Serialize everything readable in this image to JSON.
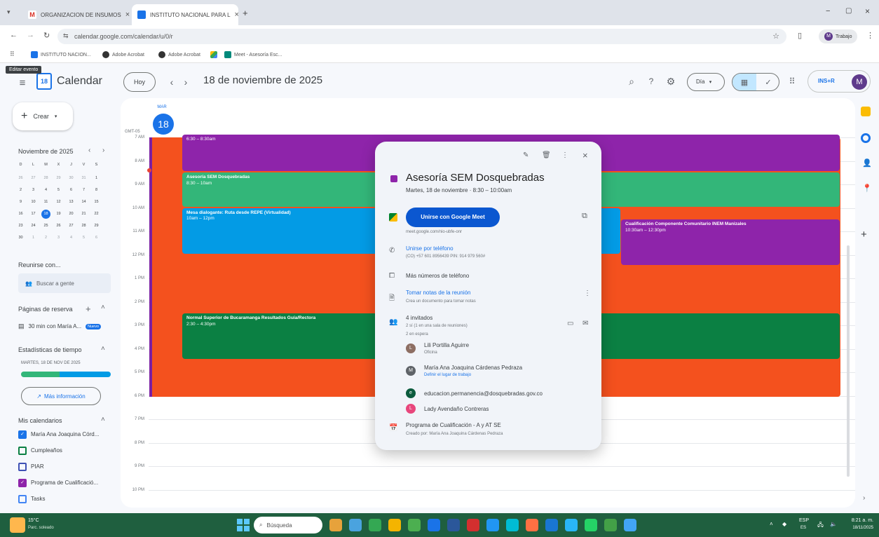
{
  "browser": {
    "tabs": [
      {
        "label": "ORGANIZACION DE INSUMOS",
        "active": false
      },
      {
        "label": "INSTITUTO NACIONAL PARA L",
        "active": true
      }
    ],
    "url": "calendar.google.com/calendar/u/0/r",
    "profile_label": "Trabajo",
    "bookmarks": [
      "INSTITUTO NACION...",
      "Adobe Acrobat",
      "Adobe Acrobat",
      "",
      "Meet - Asesoría Esc..."
    ]
  },
  "tooltip": "Editar evento",
  "header": {
    "app_name": "Calendar",
    "today_button": "Hoy",
    "date_title": "18 de noviembre de 2025",
    "view_select": "Día",
    "avatar_letter": "M",
    "brand": "INS+R"
  },
  "sidebar": {
    "create_label": "Crear",
    "mini_month": "Noviembre de 2025",
    "weekday_letters": [
      "D",
      "L",
      "M",
      "X",
      "J",
      "V",
      "S"
    ],
    "mini_days": [
      [
        "26",
        "27",
        "28",
        "29",
        "30",
        "31",
        "1"
      ],
      [
        "2",
        "3",
        "4",
        "5",
        "6",
        "7",
        "8"
      ],
      [
        "9",
        "10",
        "11",
        "12",
        "13",
        "14",
        "15"
      ],
      [
        "16",
        "17",
        "18",
        "19",
        "20",
        "21",
        "22"
      ],
      [
        "23",
        "24",
        "25",
        "26",
        "27",
        "28",
        "29"
      ],
      [
        "30",
        "1",
        "2",
        "3",
        "4",
        "5",
        "6"
      ]
    ],
    "meet_with": "Reunirse con...",
    "search_people": "Buscar a gente",
    "booking_title": "Páginas de reserva",
    "booking_item": "30 min con María A...",
    "booking_badge": "Nuevo",
    "stats_title": "Estadísticas de tiempo",
    "stats_date": "MARTES, 18 DE NOV DE 2025",
    "more_info": "Más información",
    "my_calendars": "Mis calendarios",
    "calendars": [
      {
        "label": "María Ana Joaquina Córd...",
        "checked": true,
        "color": "#1a73e8"
      },
      {
        "label": "Cumpleaños",
        "checked": false,
        "color": "#0b8043"
      },
      {
        "label": "PIAR",
        "checked": false,
        "color": "#3f51b5"
      },
      {
        "label": "Programa de Cualificació...",
        "checked": true,
        "color": "#8e24aa"
      },
      {
        "label": "Tasks",
        "checked": false,
        "color": "#4285f4"
      }
    ]
  },
  "day_header": {
    "weekday": "MAR",
    "day": "18",
    "timezone": "GMT-05"
  },
  "hours": [
    "7 AM",
    "8 AM",
    "9 AM",
    "10 AM",
    "11 AM",
    "12 PM",
    "1 PM",
    "2 PM",
    "3 PM",
    "4 PM",
    "5 PM",
    "6 PM",
    "7 PM",
    "8 PM",
    "9 PM",
    "10 PM"
  ],
  "events": [
    {
      "title": "",
      "time": "6:30 – 8:30am",
      "color": "#8e24aa"
    },
    {
      "title": "Asesoría SEM Dosquebradas",
      "time": "8:30 – 10am",
      "color": "#33b679"
    },
    {
      "title": "Mesa dialogante: Ruta desde REPE (Virtualidad)",
      "time": "10am – 12pm",
      "color": "#039be5"
    },
    {
      "title": "Cualificación Componente Comunitario INEM Manizales",
      "time": "10:30am – 12:30pm",
      "color": "#8e24aa"
    },
    {
      "title": "Normal Superior de Bucaramanga Resultados Guía/Rectora",
      "time": "2:30 – 4:30pm",
      "color": "#0b8043"
    }
  ],
  "background_event_color": "#f4511e",
  "popup": {
    "title": "Asesoría SEM Dosquebradas",
    "subtitle": "Martes, 18 de noviembre · 8:30 – 10:00am",
    "meet_button": "Unirse con Google Meet",
    "meet_link": "meet.google.com/nio-ubfe-onr",
    "phone_link": "Unirse por teléfono",
    "phone_detail": "(CO) +57 601 8956439 PIN: 914 979 560#",
    "more_numbers": "Más números de teléfono",
    "notes_link": "Tomar notas de la reunión",
    "notes_detail": "Crea un documento para tomar notas",
    "guests_title": "4 invitados",
    "guests_detail": "2 sí (1 en una sala de reuniones)",
    "guests_pending": "2 en espera",
    "guests": [
      {
        "name": "Lili Portilla Aguirre",
        "sub": "Oficina",
        "initial": "L",
        "color": "#8d6e63"
      },
      {
        "name": "María Ana Joaquina Cárdenas Pedraza",
        "sub": "Definir el lugar de trabajo",
        "initial": "M",
        "color": "#5f6368"
      },
      {
        "name": "educacion.permanencia@dosquebradas.gov.co",
        "sub": "",
        "initial": "e",
        "color": "#0b5b3d"
      },
      {
        "name": "Lady Avendaño Contreras",
        "sub": "",
        "initial": "L",
        "color": "#e8467c"
      }
    ],
    "calendar_name": "Programa de Cualificación - A y AT SE",
    "created_by": "Creado por: María Ana Joaquina Cárdenas Pedraza"
  },
  "taskbar": {
    "weather_temp": "15°C",
    "weather_desc": "Parc. soleado",
    "search_placeholder": "Búsqueda",
    "lang": "ESP",
    "lang_sub": "ES",
    "time": "8:21 a. m.",
    "date": "18/11/2025"
  }
}
